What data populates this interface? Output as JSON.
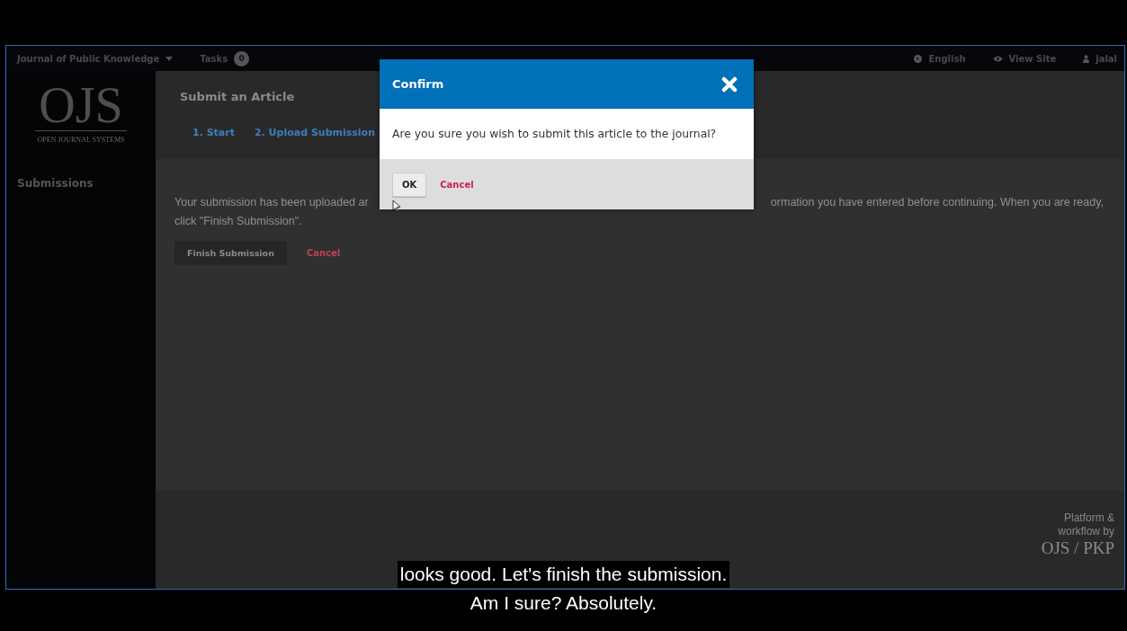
{
  "top_nav": {
    "journal": "Journal of Public Knowledge",
    "tasks": {
      "label": "Tasks",
      "count": "0"
    },
    "language": "English",
    "view_site": "View Site",
    "user": "jalal"
  },
  "sidebar": {
    "logo": {
      "mark": "OJS",
      "tagline": "OPEN JOURNAL SYSTEMS"
    },
    "items": [
      {
        "label": "Submissions"
      }
    ]
  },
  "page": {
    "title": "Submit an Article",
    "steps": [
      {
        "label": "1. Start",
        "selected": false
      },
      {
        "label": "2. Upload Submission",
        "selected": false
      }
    ],
    "message": {
      "left": "Your submission has been uploaded ar",
      "right": "ormation you have entered before continuing. When you are ready,",
      "line2": "click \"Finish Submission\"."
    },
    "buttons": {
      "finish": "Finish Submission",
      "cancel": "Cancel"
    }
  },
  "footer": {
    "text": "Platform & workflow by",
    "logo": "OJS / PKP"
  },
  "dialog": {
    "title": "Confirm",
    "message": "Are you sure you wish to submit this article to the journal?",
    "ok": "OK",
    "cancel": "Cancel"
  },
  "captions": [
    "looks good. Let's finish the submission.",
    "Am I sure? Absolutely."
  ]
}
